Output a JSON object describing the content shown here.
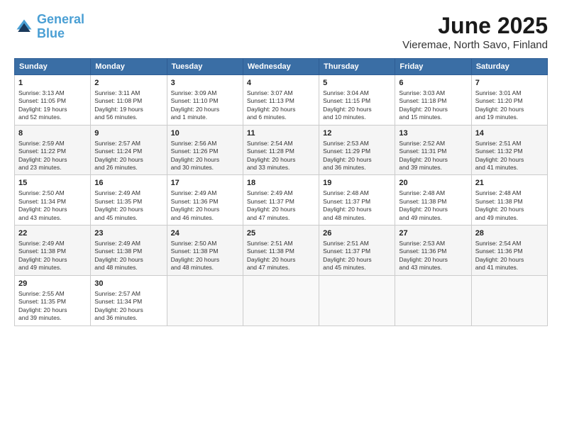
{
  "logo": {
    "line1": "General",
    "line2": "Blue"
  },
  "title": "June 2025",
  "subtitle": "Vieremae, North Savo, Finland",
  "header_days": [
    "Sunday",
    "Monday",
    "Tuesday",
    "Wednesday",
    "Thursday",
    "Friday",
    "Saturday"
  ],
  "weeks": [
    [
      {
        "day": "1",
        "info": "Sunrise: 3:13 AM\nSunset: 11:05 PM\nDaylight: 19 hours\nand 52 minutes."
      },
      {
        "day": "2",
        "info": "Sunrise: 3:11 AM\nSunset: 11:08 PM\nDaylight: 19 hours\nand 56 minutes."
      },
      {
        "day": "3",
        "info": "Sunrise: 3:09 AM\nSunset: 11:10 PM\nDaylight: 20 hours\nand 1 minute."
      },
      {
        "day": "4",
        "info": "Sunrise: 3:07 AM\nSunset: 11:13 PM\nDaylight: 20 hours\nand 6 minutes."
      },
      {
        "day": "5",
        "info": "Sunrise: 3:04 AM\nSunset: 11:15 PM\nDaylight: 20 hours\nand 10 minutes."
      },
      {
        "day": "6",
        "info": "Sunrise: 3:03 AM\nSunset: 11:18 PM\nDaylight: 20 hours\nand 15 minutes."
      },
      {
        "day": "7",
        "info": "Sunrise: 3:01 AM\nSunset: 11:20 PM\nDaylight: 20 hours\nand 19 minutes."
      }
    ],
    [
      {
        "day": "8",
        "info": "Sunrise: 2:59 AM\nSunset: 11:22 PM\nDaylight: 20 hours\nand 23 minutes."
      },
      {
        "day": "9",
        "info": "Sunrise: 2:57 AM\nSunset: 11:24 PM\nDaylight: 20 hours\nand 26 minutes."
      },
      {
        "day": "10",
        "info": "Sunrise: 2:56 AM\nSunset: 11:26 PM\nDaylight: 20 hours\nand 30 minutes."
      },
      {
        "day": "11",
        "info": "Sunrise: 2:54 AM\nSunset: 11:28 PM\nDaylight: 20 hours\nand 33 minutes."
      },
      {
        "day": "12",
        "info": "Sunrise: 2:53 AM\nSunset: 11:29 PM\nDaylight: 20 hours\nand 36 minutes."
      },
      {
        "day": "13",
        "info": "Sunrise: 2:52 AM\nSunset: 11:31 PM\nDaylight: 20 hours\nand 39 minutes."
      },
      {
        "day": "14",
        "info": "Sunrise: 2:51 AM\nSunset: 11:32 PM\nDaylight: 20 hours\nand 41 minutes."
      }
    ],
    [
      {
        "day": "15",
        "info": "Sunrise: 2:50 AM\nSunset: 11:34 PM\nDaylight: 20 hours\nand 43 minutes."
      },
      {
        "day": "16",
        "info": "Sunrise: 2:49 AM\nSunset: 11:35 PM\nDaylight: 20 hours\nand 45 minutes."
      },
      {
        "day": "17",
        "info": "Sunrise: 2:49 AM\nSunset: 11:36 PM\nDaylight: 20 hours\nand 46 minutes."
      },
      {
        "day": "18",
        "info": "Sunrise: 2:49 AM\nSunset: 11:37 PM\nDaylight: 20 hours\nand 47 minutes."
      },
      {
        "day": "19",
        "info": "Sunrise: 2:48 AM\nSunset: 11:37 PM\nDaylight: 20 hours\nand 48 minutes."
      },
      {
        "day": "20",
        "info": "Sunrise: 2:48 AM\nSunset: 11:38 PM\nDaylight: 20 hours\nand 49 minutes."
      },
      {
        "day": "21",
        "info": "Sunrise: 2:48 AM\nSunset: 11:38 PM\nDaylight: 20 hours\nand 49 minutes."
      }
    ],
    [
      {
        "day": "22",
        "info": "Sunrise: 2:49 AM\nSunset: 11:38 PM\nDaylight: 20 hours\nand 49 minutes."
      },
      {
        "day": "23",
        "info": "Sunrise: 2:49 AM\nSunset: 11:38 PM\nDaylight: 20 hours\nand 48 minutes."
      },
      {
        "day": "24",
        "info": "Sunrise: 2:50 AM\nSunset: 11:38 PM\nDaylight: 20 hours\nand 48 minutes."
      },
      {
        "day": "25",
        "info": "Sunrise: 2:51 AM\nSunset: 11:38 PM\nDaylight: 20 hours\nand 47 minutes."
      },
      {
        "day": "26",
        "info": "Sunrise: 2:51 AM\nSunset: 11:37 PM\nDaylight: 20 hours\nand 45 minutes."
      },
      {
        "day": "27",
        "info": "Sunrise: 2:53 AM\nSunset: 11:36 PM\nDaylight: 20 hours\nand 43 minutes."
      },
      {
        "day": "28",
        "info": "Sunrise: 2:54 AM\nSunset: 11:36 PM\nDaylight: 20 hours\nand 41 minutes."
      }
    ],
    [
      {
        "day": "29",
        "info": "Sunrise: 2:55 AM\nSunset: 11:35 PM\nDaylight: 20 hours\nand 39 minutes."
      },
      {
        "day": "30",
        "info": "Sunrise: 2:57 AM\nSunset: 11:34 PM\nDaylight: 20 hours\nand 36 minutes."
      },
      null,
      null,
      null,
      null,
      null
    ]
  ]
}
